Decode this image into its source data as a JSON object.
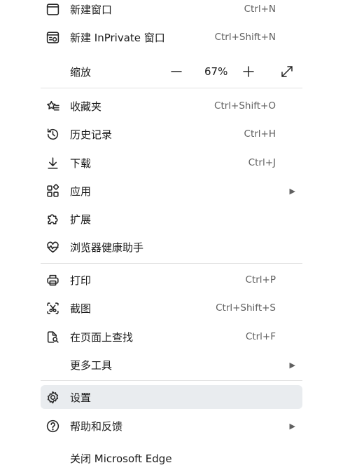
{
  "menu": {
    "new_window": {
      "label": "新建窗口",
      "shortcut": "Ctrl+N",
      "icon": "window-icon"
    },
    "new_inprivate": {
      "label": "新建 InPrivate 窗口",
      "shortcut": "Ctrl+Shift+N",
      "icon": "inprivate-icon"
    },
    "zoom": {
      "label": "缩放",
      "value": "67%",
      "decrease_icon": "minus-icon",
      "increase_icon": "plus-icon",
      "fullscreen_icon": "expand-icon"
    },
    "favorites": {
      "label": "收藏夹",
      "shortcut": "Ctrl+Shift+O",
      "icon": "favorites-icon"
    },
    "history": {
      "label": "历史记录",
      "shortcut": "Ctrl+H",
      "icon": "history-icon"
    },
    "downloads": {
      "label": "下载",
      "shortcut": "Ctrl+J",
      "icon": "download-icon"
    },
    "apps": {
      "label": "应用",
      "icon": "apps-icon"
    },
    "extensions": {
      "label": "扩展",
      "icon": "puzzle-icon"
    },
    "health": {
      "label": "浏览器健康助手",
      "icon": "heartbeat-icon"
    },
    "print": {
      "label": "打印",
      "shortcut": "Ctrl+P",
      "icon": "printer-icon"
    },
    "screenshot": {
      "label": "截图",
      "shortcut": "Ctrl+Shift+S",
      "icon": "scissors-icon"
    },
    "find": {
      "label": "在页面上查找",
      "shortcut": "Ctrl+F",
      "icon": "find-page-icon"
    },
    "more_tools": {
      "label": "更多工具"
    },
    "settings": {
      "label": "设置",
      "icon": "gear-icon"
    },
    "help": {
      "label": "帮助和反馈",
      "icon": "help-icon"
    },
    "close": {
      "label": "关闭 Microsoft Edge"
    }
  }
}
